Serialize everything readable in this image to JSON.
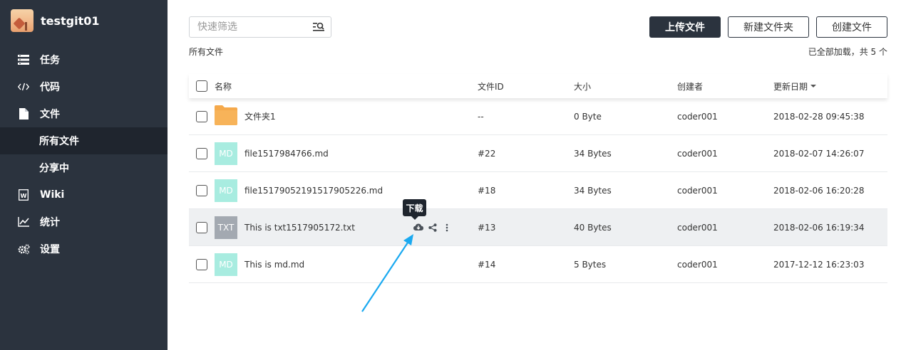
{
  "sidebar": {
    "project_name": "testgit01",
    "items": [
      {
        "label": "任务",
        "icon": "tasks-icon"
      },
      {
        "label": "代码",
        "icon": "code-icon"
      },
      {
        "label": "文件",
        "icon": "file-icon"
      },
      {
        "label": "所有文件",
        "icon": ""
      },
      {
        "label": "分享中",
        "icon": ""
      },
      {
        "label": "Wiki",
        "icon": "wiki-icon"
      },
      {
        "label": "统计",
        "icon": "chart-icon"
      },
      {
        "label": "设置",
        "icon": "settings-icon"
      }
    ],
    "active_item": "所有文件"
  },
  "toolbar": {
    "search_placeholder": "快速筛选",
    "upload_label": "上传文件",
    "new_folder_label": "新建文件夹",
    "create_file_label": "创建文件"
  },
  "breadcrumb": "所有文件",
  "load_status": "已全部加载，共 5 个",
  "table": {
    "headers": {
      "name": "名称",
      "file_id": "文件ID",
      "size": "大小",
      "creator": "创建者",
      "updated": "更新日期"
    },
    "rows": [
      {
        "type": "folder",
        "thumb": "",
        "name": "文件夹1",
        "file_id": "--",
        "size": "0 Byte",
        "creator": "coder001",
        "updated": "2018-02-28 09:45:38"
      },
      {
        "type": "md",
        "thumb": "MD",
        "name": "file1517984766.md",
        "file_id": "#22",
        "size": "34 Bytes",
        "creator": "coder001",
        "updated": "2018-02-07 14:26:07"
      },
      {
        "type": "md",
        "thumb": "MD",
        "name": "file15179052191517905226.md",
        "file_id": "#18",
        "size": "34 Bytes",
        "creator": "coder001",
        "updated": "2018-02-06 16:20:28"
      },
      {
        "type": "txt",
        "thumb": "TXT",
        "name": "This is txt1517905172.txt",
        "file_id": "#13",
        "size": "40 Bytes",
        "creator": "coder001",
        "updated": "2018-02-06 16:19:34"
      },
      {
        "type": "md",
        "thumb": "MD",
        "name": "This is md.md",
        "file_id": "#14",
        "size": "5 Bytes",
        "creator": "coder001",
        "updated": "2017-12-12 16:23:03"
      }
    ]
  },
  "tooltip": "下载",
  "colors": {
    "sidebar_bg": "#2b333e",
    "sidebar_active": "#1f252e",
    "md_thumb": "#a8ece0",
    "txt_thumb": "#a3a9b1",
    "folder": "#f5a94b",
    "annotation_arrow": "#1aa9f0"
  }
}
